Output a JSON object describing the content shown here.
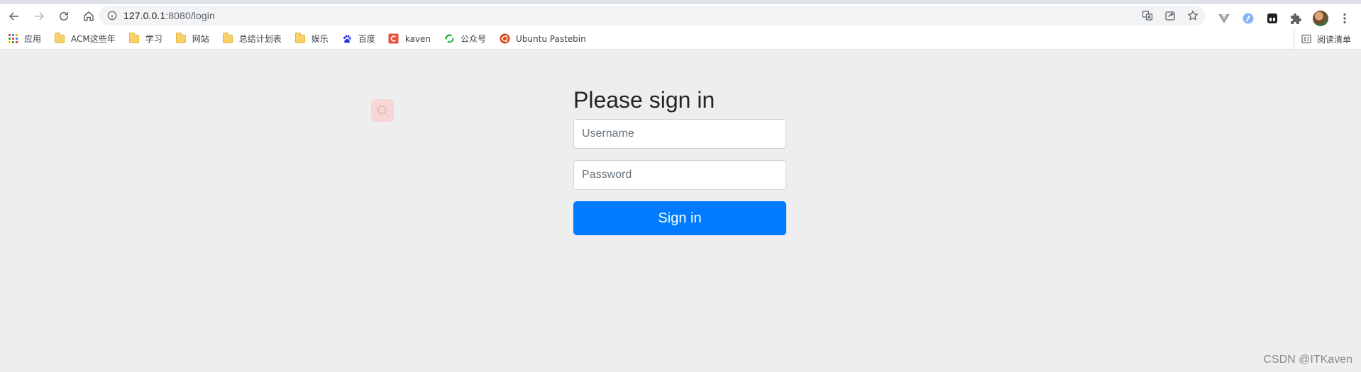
{
  "browser": {
    "url_host": "127.0.0.1",
    "url_path": ":8080/login"
  },
  "bookmarks": [
    {
      "label": "应用",
      "icon": "apps-grid-icon"
    },
    {
      "label": "ACM这些年",
      "icon": "folder-icon"
    },
    {
      "label": "学习",
      "icon": "folder-icon"
    },
    {
      "label": "网站",
      "icon": "folder-icon"
    },
    {
      "label": "总结计划表",
      "icon": "folder-icon"
    },
    {
      "label": "娱乐",
      "icon": "folder-icon"
    },
    {
      "label": "百度",
      "icon": "baidu-paw-icon"
    },
    {
      "label": "kaven",
      "icon": "csdn-c-icon"
    },
    {
      "label": "公众号",
      "icon": "wechat-loop-icon"
    },
    {
      "label": "Ubuntu Pastebin",
      "icon": "ubuntu-icon"
    }
  ],
  "reading_list": {
    "label": "阅读清单"
  },
  "signin": {
    "heading": "Please sign in",
    "username_placeholder": "Username",
    "password_placeholder": "Password",
    "button_label": "Sign in"
  },
  "watermark": "CSDN @ITKaven",
  "colors": {
    "primary": "#007bff",
    "page_bg": "#eeeeee"
  }
}
